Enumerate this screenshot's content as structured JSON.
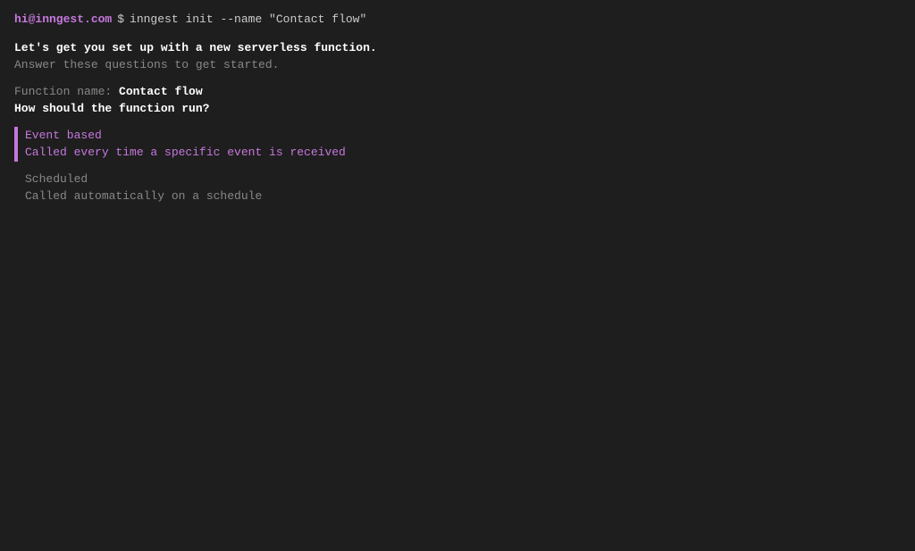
{
  "terminal": {
    "prompt": {
      "user": "hi@inngest.com",
      "dollar": "$",
      "command": "inngest init --name \"Contact flow\""
    },
    "intro": {
      "bold_line": "Let's get you set up with a new serverless function.",
      "normal_line": "Answer these questions to get started."
    },
    "function_label": "Function name: ",
    "function_name": "Contact flow",
    "question": "How should the function run?",
    "options": [
      {
        "id": "event-based",
        "title": "Event based",
        "description": "Called every time a specific event is received",
        "selected": true
      },
      {
        "id": "scheduled",
        "title": "Scheduled",
        "description": "Called automatically on a schedule",
        "selected": false
      }
    ]
  }
}
